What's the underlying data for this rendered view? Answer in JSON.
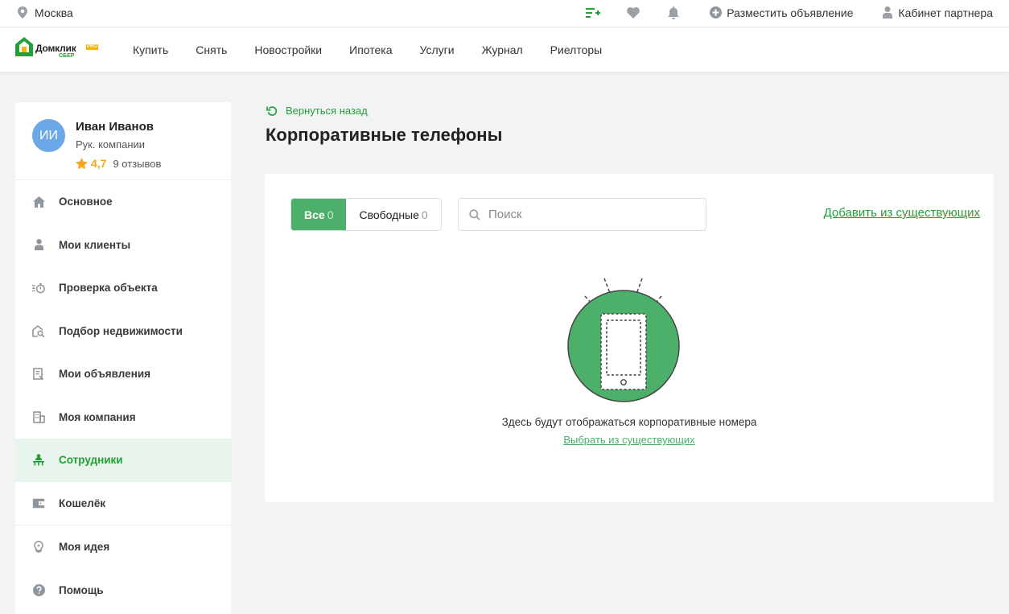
{
  "topbar": {
    "city": "Москва",
    "post_ad": "Разместить объявление",
    "partner_cabinet": "Кабинет партнера"
  },
  "logo": {
    "name": "Домклик",
    "pro": "PRO",
    "sber": "СБЕР"
  },
  "nav": {
    "items": [
      "Купить",
      "Снять",
      "Новостройки",
      "Ипотека",
      "Услуги",
      "Журнал",
      "Риелторы"
    ]
  },
  "profile": {
    "initials": "ИИ",
    "name": "Иван Иванов",
    "role": "Рук. компании",
    "rating": "4,7",
    "reviews": "9 отзывов"
  },
  "sidebar": {
    "items": [
      {
        "label": "Основное",
        "icon": "home-icon"
      },
      {
        "label": "Мои клиенты",
        "icon": "person-icon"
      },
      {
        "label": "Проверка объекта",
        "icon": "check-timer-icon"
      },
      {
        "label": "Подбор недвижимости",
        "icon": "house-search-icon"
      },
      {
        "label": "Мои объявления",
        "icon": "ads-icon"
      },
      {
        "label": "Моя компания",
        "icon": "building-icon"
      },
      {
        "label": "Сотрудники",
        "icon": "employees-icon"
      },
      {
        "label": "Кошелёк",
        "icon": "wallet-icon"
      },
      {
        "label": "Моя идея",
        "icon": "idea-icon"
      },
      {
        "label": "Помощь",
        "icon": "help-icon"
      }
    ],
    "active_index": 6
  },
  "main": {
    "back_label": "Вернуться назад",
    "title": "Корпоративные телефоны",
    "filter": {
      "all_label": "Все",
      "all_count": "0",
      "free_label": "Свободные",
      "free_count": "0"
    },
    "search_placeholder": "Поиск",
    "add_link": "Добавить из существующих",
    "empty_text": "Здесь будут отображаться корпоративные номера",
    "empty_link": "Выбрать из существующих"
  },
  "colors": {
    "accent": "#21a038",
    "accent_light": "#4caf6a",
    "active_bg": "#e8f5ec",
    "page_bg": "#f2f3f5",
    "avatar": "#6aa8e8",
    "star": "#f5a623"
  }
}
